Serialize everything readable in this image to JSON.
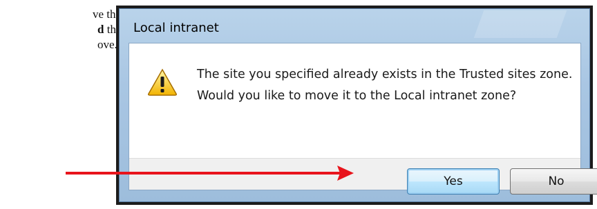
{
  "document_text": {
    "line1": "ve this",
    "line2_bold": "d",
    "line2_rest": " the trusted",
    "line3": "ove."
  },
  "dialog": {
    "title": "Local intranet",
    "icon": "warning-icon",
    "message": "The site you specified already exists in the Trusted sites zone.  Would you like to move it to the Local intranet zone?",
    "buttons": {
      "yes": "Yes",
      "no": "No"
    }
  },
  "annotation": {
    "arrow_color": "#e8141c"
  }
}
